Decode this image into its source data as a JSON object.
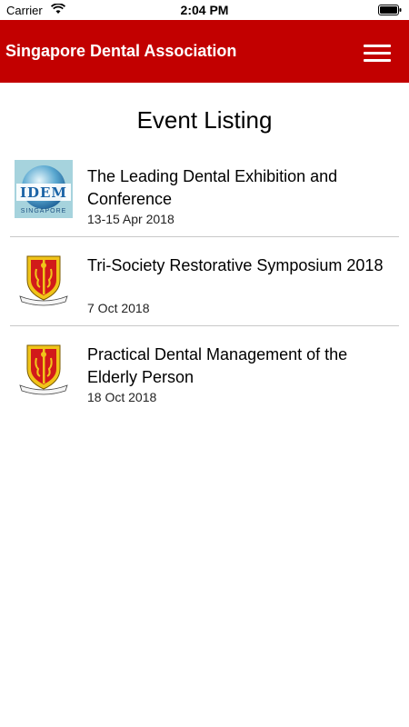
{
  "status_bar": {
    "carrier": "Carrier",
    "time": "2:04 PM"
  },
  "header": {
    "title": "Singapore Dental Association",
    "menu_icon": "hamburger-menu-icon",
    "background_color": "#c20000"
  },
  "page": {
    "title": "Event Listing"
  },
  "events": [
    {
      "title": "The Leading Dental Exhibition and Conference",
      "date": "13-15 Apr 2018",
      "logo": "idem-singapore-logo",
      "logo_text": "IDEM",
      "logo_subtext": "SINGAPORE"
    },
    {
      "title": "Tri-Society Restorative Symposium 2018",
      "date": "7 Oct 2018",
      "logo": "singapore-dental-association-crest-logo"
    },
    {
      "title": "Practical Dental Management of the Elderly Person",
      "date": "18 Oct 2018",
      "logo": "singapore-dental-association-crest-logo"
    }
  ]
}
